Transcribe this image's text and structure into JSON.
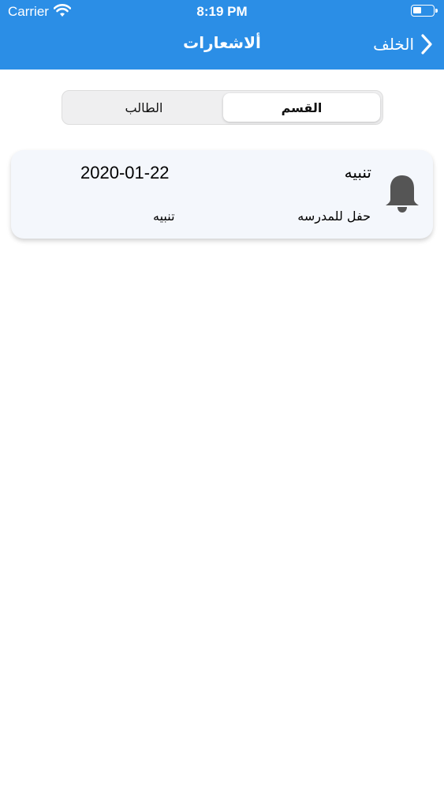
{
  "status_bar": {
    "carrier": "Carrier",
    "time": "8:19 PM",
    "battery_level": 0.45
  },
  "nav": {
    "title": "ألاشعارات",
    "back_label": "الخلف"
  },
  "segments": [
    {
      "label": "القسم",
      "selected": true
    },
    {
      "label": "الطالب",
      "selected": false
    }
  ],
  "notifications": [
    {
      "title": "تنبيه",
      "date": "2020-01-22",
      "body": "حفل للمدرسه",
      "type": "تنبيه",
      "icon": "bell-icon"
    }
  ],
  "colors": {
    "header": "#2b8ee6",
    "card_background": "#f4f7fc",
    "bell": "#555555"
  }
}
